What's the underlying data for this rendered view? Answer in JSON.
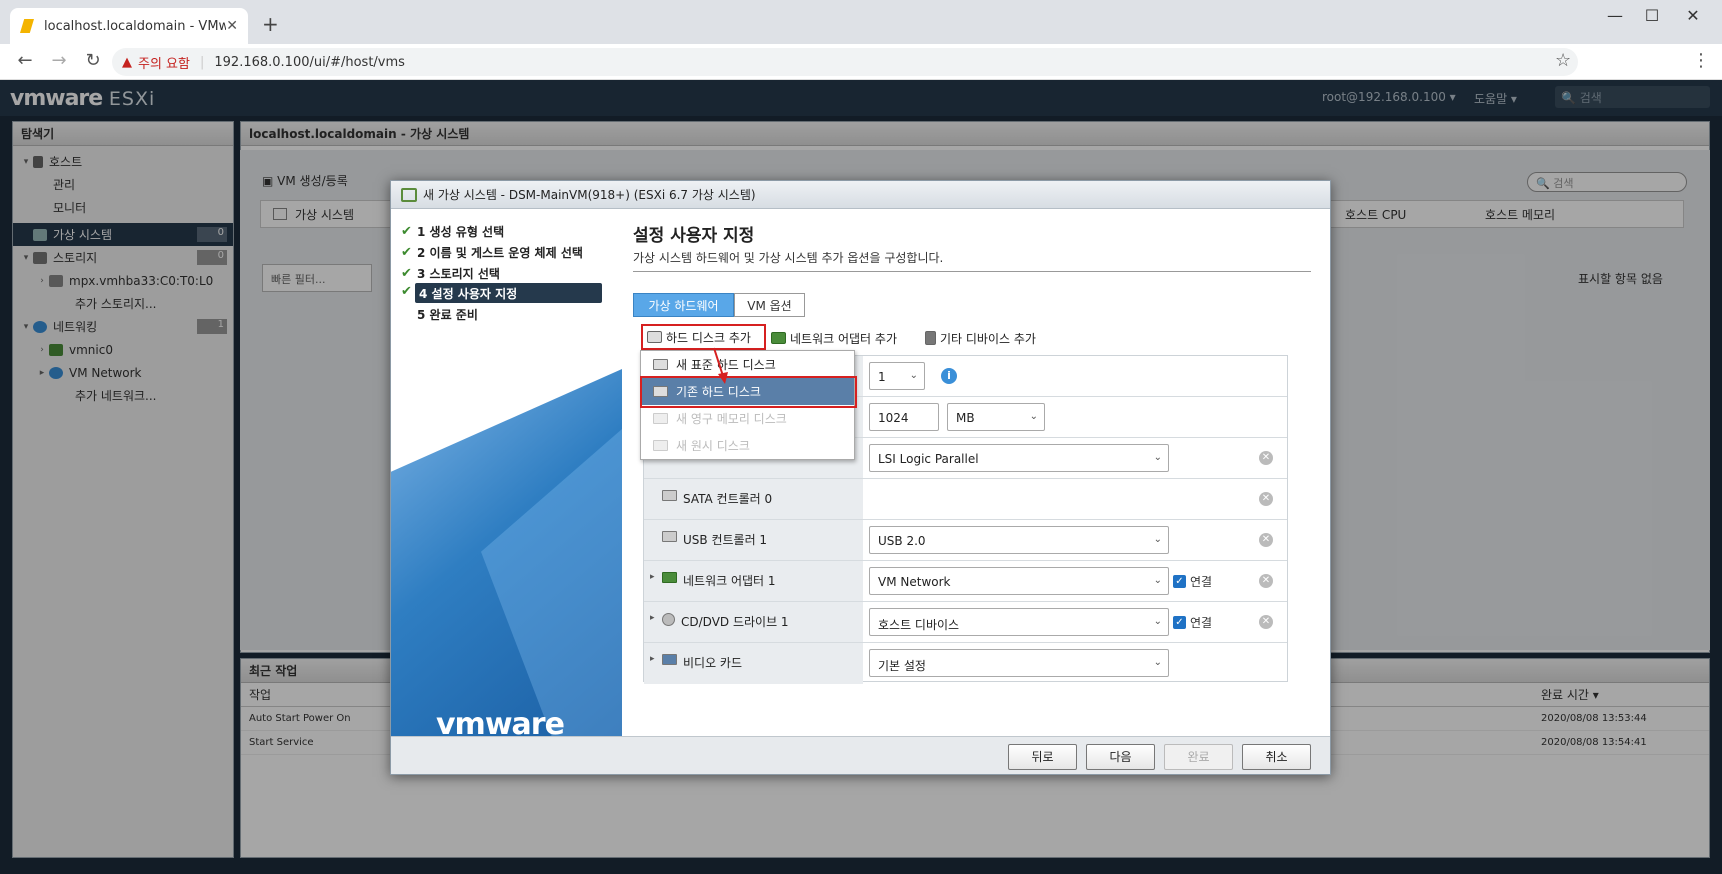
{
  "browser": {
    "tab_title": "localhost.localdomain - VMware",
    "new_tab": "+",
    "warning_text": "주의 요함",
    "url": "192.168.0.100/ui/#/host/vms"
  },
  "esxi": {
    "logo_main": "vmware",
    "logo_product": "ESXi",
    "user": "root@192.168.0.100 ▾",
    "help": "도움말 ▾",
    "search_placeholder": "검색"
  },
  "sidebar": {
    "title": "탐색기",
    "items": [
      {
        "label": "호스트"
      },
      {
        "label": "관리"
      },
      {
        "label": "모니터"
      },
      {
        "label": "가상 시스템",
        "count": "0"
      },
      {
        "label": "스토리지",
        "count": "0"
      },
      {
        "label": "mpx.vmhba33:C0:T0:L0"
      },
      {
        "label": "추가 스토리지..."
      },
      {
        "label": "네트워킹",
        "count": "1"
      },
      {
        "label": "vmnic0"
      },
      {
        "label": "VM Network"
      },
      {
        "label": "추가 네트워크..."
      }
    ]
  },
  "main": {
    "title": "localhost.localdomain - 가상 시스템",
    "create_vm": "VM 생성/등록",
    "search_placeholder": "검색",
    "col_vm": "가상 시스템",
    "col_cpu": "호스트 CPU",
    "col_mem": "호스트 메모리",
    "quick_filter": "빠른 필터...",
    "no_items": "표시할 항목 없음"
  },
  "recent": {
    "title": "최근 작업",
    "col_task": "작업",
    "col_time": "완료 시간 ▾",
    "tasks": [
      {
        "name": "Auto Start Power On",
        "time": "2020/08/08 13:53:44"
      },
      {
        "name": "Start Service",
        "time": "2020/08/08 13:54:41"
      }
    ]
  },
  "dialog": {
    "title": "새 가상 시스템 - DSM-MainVM(918+) (ESXi 6.7 가상 시스템)",
    "steps": [
      {
        "label": "1 생성 유형 선택",
        "done": true
      },
      {
        "label": "2 이름 및 게스트 운영 체제 선택",
        "done": true
      },
      {
        "label": "3 스토리지 선택",
        "done": true
      },
      {
        "label": "4 설정 사용자 지정",
        "done": true
      },
      {
        "label": "5 완료 준비",
        "done": false
      }
    ],
    "left_logo": "vmware",
    "heading": "설정 사용자 지정",
    "subtitle": "가상 시스템 하드웨어 및 가상 시스템 추가 옵션을 구성합니다.",
    "tab_hw": "가상 하드웨어",
    "tab_vm": "VM 옵션",
    "add_disk": "하드 디스크 추가",
    "add_nic": "네트워크 어댑터 추가",
    "add_other": "기타 디바이스 추가",
    "hw_rows": {
      "cpu_value": "1",
      "mem_value": "1024",
      "mem_unit": "MB",
      "scsi_value": "LSI Logic Parallel",
      "sata_label": "SATA 컨트롤러 0",
      "usb_label": "USB 컨트롤러 1",
      "usb_value": "USB 2.0",
      "nic_label": "네트워크 어댑터 1",
      "nic_value": "VM Network",
      "nic_connect": "연결",
      "cd_label": "CD/DVD 드라이브 1",
      "cd_value": "호스트 디바이스",
      "cd_connect": "연결",
      "video_label": "비디오 카드",
      "video_value": "기본 설정"
    },
    "dropdown": [
      {
        "label": "새 표준 하드 디스크",
        "state": "normal"
      },
      {
        "label": "기존 하드 디스크",
        "state": "highlighted"
      },
      {
        "label": "새 영구 메모리 디스크",
        "state": "disabled"
      },
      {
        "label": "새 원시 디스크",
        "state": "disabled"
      }
    ],
    "btn_back": "뒤로",
    "btn_next": "다음",
    "btn_finish": "완료",
    "btn_cancel": "취소"
  }
}
